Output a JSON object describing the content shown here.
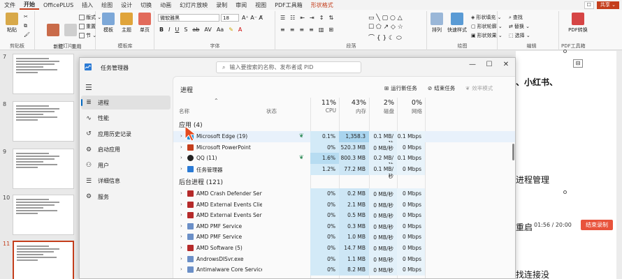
{
  "menubar": {
    "tabs": [
      "文件",
      "开始",
      "OfficePLUS",
      "插入",
      "绘图",
      "设计",
      "切换",
      "动画",
      "幻灯片放映",
      "录制",
      "审阅",
      "视图",
      "PDF工具箱",
      "形状格式"
    ],
    "active_tab": "开始",
    "comment_label": "☐",
    "share_label": "共享 ⌄"
  },
  "ribbon": {
    "clipboard": {
      "paste": "粘贴",
      "label": "剪贴板"
    },
    "slides": {
      "new_slide": "新建\n幻灯片",
      "reuse": "重用\n幻灯片",
      "layout": "版式 ⌄",
      "reset": "重置",
      "section": "节 ⌄",
      "label": "幻灯片"
    },
    "template": {
      "template": "模板",
      "theme": "主题",
      "single": "单页",
      "label": "模板库"
    },
    "font": {
      "font_name": "微软雅黑",
      "font_size": "18",
      "label": "字体"
    },
    "paragraph": {
      "label": "段落"
    },
    "drawing": {
      "arrange": "排列",
      "quick_styles": "快速样式",
      "fill": "形状填充 ⌄",
      "outline": "形状轮廓 ⌄",
      "effects": "形状效果 ⌄",
      "label": "绘图"
    },
    "editing": {
      "find": "查找",
      "replace": "替换 ⌄",
      "select": "选择 ⌄",
      "label": "编辑"
    },
    "pdf": {
      "translate": "PDF转换",
      "label": "PDF工具箱"
    }
  },
  "slides_pane": {
    "numbers": [
      "7",
      "8",
      "9",
      "10",
      "11"
    ]
  },
  "canvas": {
    "lines": [
      "、小红书、",
      "进程管理",
      "重启",
      "找连接没"
    ]
  },
  "task_manager": {
    "title": "任务管理器",
    "search_placeholder": "输入要搜索的名称、发布者或 PID",
    "nav": [
      {
        "icon": "≣",
        "label": "进程"
      },
      {
        "icon": "∿",
        "label": "性能"
      },
      {
        "icon": "↺",
        "label": "应用历史记录"
      },
      {
        "icon": "⚙",
        "label": "启动应用"
      },
      {
        "icon": "⚇",
        "label": "用户"
      },
      {
        "icon": "☰",
        "label": "详细信息"
      },
      {
        "icon": "⚙",
        "label": "服务"
      }
    ],
    "header_title": "进程",
    "toolbar": {
      "run": "运行新任务",
      "end": "结束任务",
      "efficiency": "效率模式"
    },
    "columns": {
      "name": "名称",
      "status": "状态",
      "cpu_pct": "11%",
      "cpu": "CPU",
      "mem_pct": "43%",
      "mem": "内存",
      "disk_pct": "2%",
      "disk": "磁盘",
      "net_pct": "0%",
      "net": "网络"
    },
    "apps_header": "应用 (4)",
    "apps": [
      {
        "name": "Microsoft Edge (19)",
        "cpu": "0.1%",
        "mem": "1,358.3 ...",
        "disk": "0.1 MB/秒",
        "net": "0.1 Mbps",
        "color": "#1f8fd6",
        "status": true
      },
      {
        "name": "Microsoft PowerPoint",
        "cpu": "0%",
        "mem": "520.3 MB",
        "disk": "0 MB/秒",
        "net": "0 Mbps",
        "color": "#c43e1c",
        "status": false
      },
      {
        "name": "QQ (11)",
        "cpu": "1.6%",
        "mem": "800.3 MB",
        "disk": "0.2 MB/秒",
        "net": "0.1 Mbps",
        "color": "#222222",
        "status": true
      },
      {
        "name": "任务管理器",
        "cpu": "1.2%",
        "mem": "77.2 MB",
        "disk": "0.1 MB/秒",
        "net": "0 Mbps",
        "color": "#2a7ad5",
        "status": false
      }
    ],
    "bg_header": "后台进程 (121)",
    "background": [
      {
        "name": "AMD Crash Defender Service",
        "cpu": "0%",
        "mem": "0.2 MB",
        "disk": "0 MB/秒",
        "net": "0 Mbps",
        "color": "#b52a2a"
      },
      {
        "name": "AMD External Events Client ...",
        "cpu": "0%",
        "mem": "2.1 MB",
        "disk": "0 MB/秒",
        "net": "0 Mbps",
        "color": "#b52a2a"
      },
      {
        "name": "AMD External Events Service...",
        "cpu": "0%",
        "mem": "0.5 MB",
        "disk": "0 MB/秒",
        "net": "0 Mbps",
        "color": "#b52a2a"
      },
      {
        "name": "AMD PMF Service",
        "cpu": "0%",
        "mem": "0.3 MB",
        "disk": "0 MB/秒",
        "net": "0 Mbps",
        "color": "#6b8fc7"
      },
      {
        "name": "AMD PMF Service",
        "cpu": "0%",
        "mem": "1.0 MB",
        "disk": "0 MB/秒",
        "net": "0 Mbps",
        "color": "#6b8fc7"
      },
      {
        "name": "AMD Software (5)",
        "cpu": "0%",
        "mem": "14.7 MB",
        "disk": "0 MB/秒",
        "net": "0 Mbps",
        "color": "#b52a2a"
      },
      {
        "name": "AndrowsDISvr.exe",
        "cpu": "0%",
        "mem": "1.1 MB",
        "disk": "0 MB/秒",
        "net": "0 Mbps",
        "color": "#6b8fc7"
      },
      {
        "name": "Antimalware Core Service",
        "cpu": "0%",
        "mem": "8.2 MB",
        "disk": "0 MB/秒",
        "net": "0 Mbps",
        "color": "#6b8fc7"
      }
    ]
  },
  "recording": {
    "time": "01:56 / 20:00",
    "stop_label": "结束录制"
  }
}
